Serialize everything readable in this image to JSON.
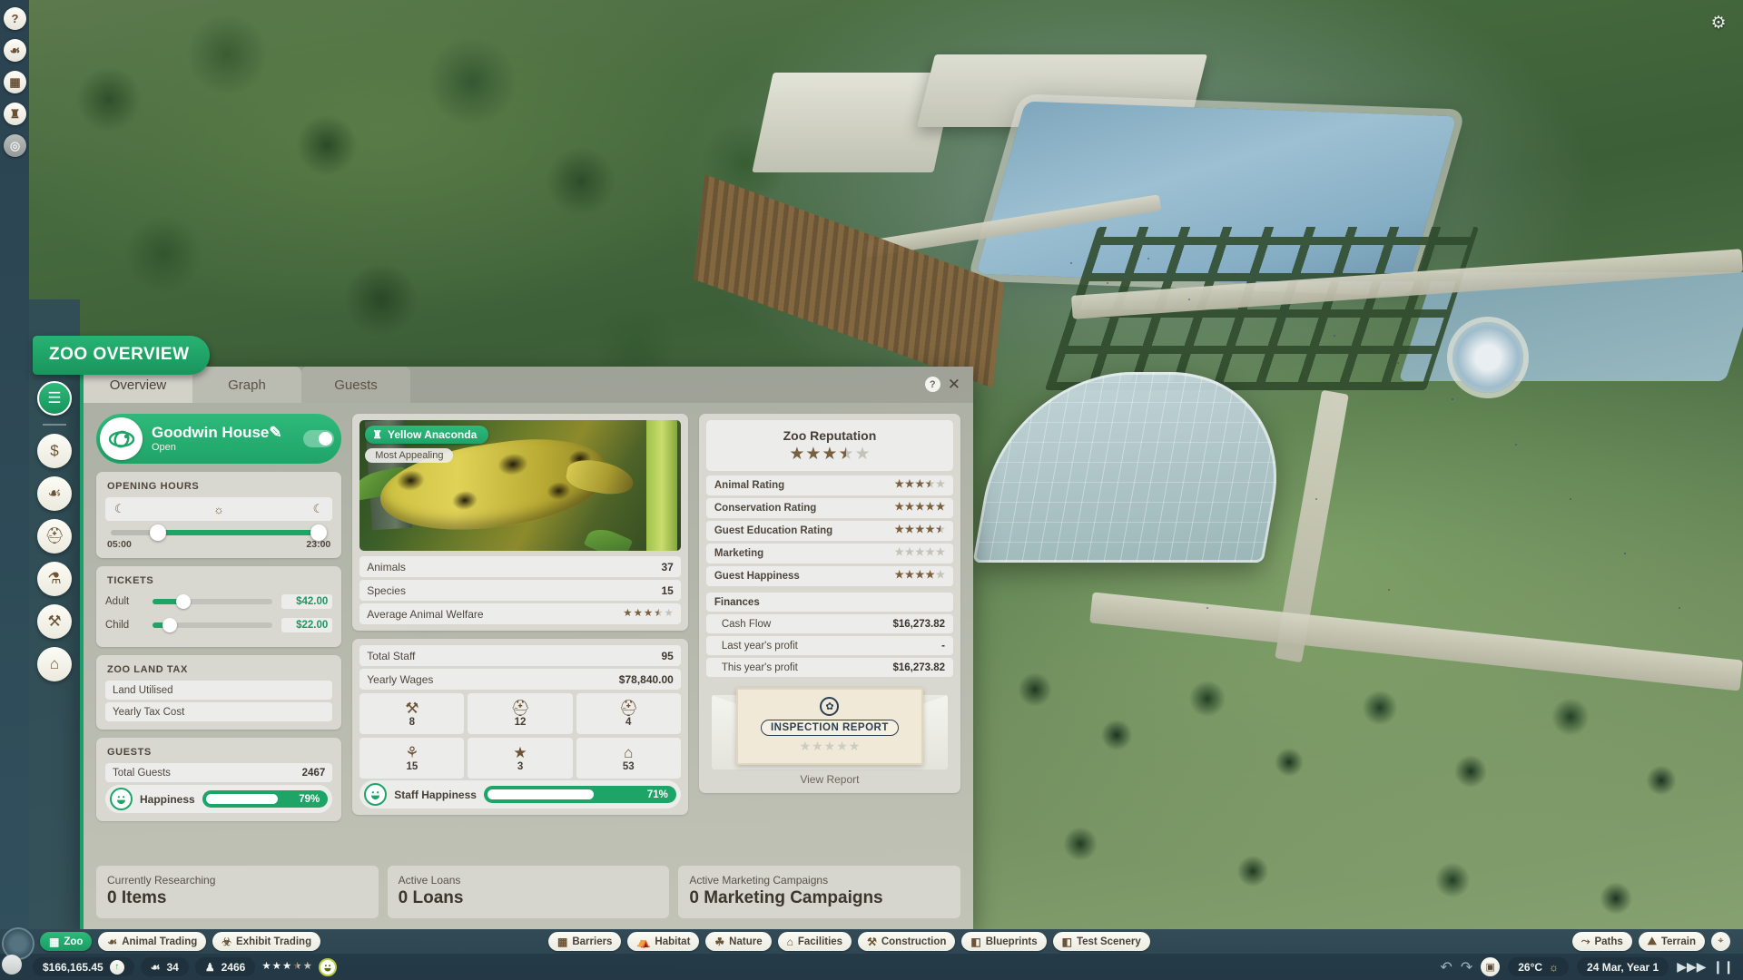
{
  "window": {
    "title": "ZOO OVERVIEW",
    "tabs": [
      {
        "label": "Overview",
        "active": true
      },
      {
        "label": "Graph",
        "active": false
      },
      {
        "label": "Guests",
        "active": false
      }
    ],
    "help_label": "?",
    "close_label": "✕"
  },
  "zoo": {
    "name": "Goodwin House",
    "name_edit_icon": "✎",
    "status": "Open",
    "logo_icon": "zoo-logo-icon"
  },
  "opening_hours": {
    "title": "OPENING HOURS",
    "icon_night_left": "☾",
    "icon_day": "☼",
    "icon_night_right": "☾",
    "start": "05:00",
    "end": "23:00",
    "fill_start_pct": 22,
    "fill_end_pct": 96
  },
  "tickets": {
    "title": "TICKETS",
    "rows": [
      {
        "label": "Adult",
        "price": "$42.00",
        "slider_pct": 26
      },
      {
        "label": "Child",
        "price": "$22.00",
        "slider_pct": 14
      }
    ]
  },
  "land_tax": {
    "title": "ZOO LAND TAX",
    "rows": [
      {
        "label": "Land Utilised",
        "value": ""
      },
      {
        "label": "Yearly Tax Cost",
        "value": ""
      }
    ]
  },
  "guests": {
    "title": "GUESTS",
    "total_label": "Total Guests",
    "total_value": "2467",
    "happiness_label": "Happiness",
    "happiness_value": "79%",
    "happiness_pct": 79,
    "face_icon": "◡"
  },
  "animal_card": {
    "badge_label": "Yellow Anaconda",
    "badge_icon": "♜",
    "sub_badge": "Most Appealing",
    "rows": [
      {
        "label": "Animals",
        "value": "37"
      },
      {
        "label": "Species",
        "value": "15"
      }
    ],
    "welfare_label": "Average Animal Welfare",
    "welfare_stars": 3.5
  },
  "staff": {
    "total_label": "Total Staff",
    "total_value": "95",
    "wages_label": "Yearly Wages",
    "wages_value": "$78,840.00",
    "cells": [
      {
        "icon": "⚒",
        "icon_name": "wrench-icon",
        "count": "8"
      },
      {
        "icon": "⛑",
        "icon_name": "keeper-icon",
        "count": "12"
      },
      {
        "icon": "⛑",
        "icon_name": "vet-bag-icon",
        "count": "4"
      },
      {
        "icon": "⚘",
        "icon_name": "broom-icon",
        "count": "15"
      },
      {
        "icon": "★",
        "icon_name": "security-badge-icon",
        "count": "3"
      },
      {
        "icon": "⌂",
        "icon_name": "shop-icon",
        "count": "53"
      }
    ],
    "happiness_label": "Staff Happiness",
    "happiness_value": "71%",
    "happiness_pct": 71
  },
  "reputation": {
    "title": "Zoo Reputation",
    "overall_stars": 3.5,
    "rows": [
      {
        "label": "Animal Rating",
        "stars": 3.5
      },
      {
        "label": "Conservation Rating",
        "stars": 5
      },
      {
        "label": "Guest Education Rating",
        "stars": 4.5
      },
      {
        "label": "Marketing",
        "stars": 0
      },
      {
        "label": "Guest Happiness",
        "stars": 4
      }
    ]
  },
  "finances": {
    "title": "Finances",
    "rows": [
      {
        "label": "Cash Flow",
        "value": "$16,273.82"
      },
      {
        "label": "Last year's profit",
        "value": "-"
      },
      {
        "label": "This year's profit",
        "value": "$16,273.82"
      }
    ]
  },
  "inspection": {
    "seal_icon": "✿",
    "title": "INSPECTION REPORT",
    "stars": 0,
    "view_label": "View Report"
  },
  "bottom_cards": [
    {
      "label": "Currently Researching",
      "value": "0 Items"
    },
    {
      "label": "Active Loans",
      "value": "0 Loans"
    },
    {
      "label": "Active Marketing Campaigns",
      "value": "0 Marketing Campaigns"
    }
  ],
  "left_rail_icons": [
    {
      "name": "help-icon",
      "glyph": "?"
    },
    {
      "name": "animal-book-icon",
      "glyph": "☙"
    },
    {
      "name": "calendar-icon",
      "glyph": "▦"
    },
    {
      "name": "trophy-icon",
      "glyph": "♜"
    },
    {
      "name": "eye-icon",
      "glyph": "◎"
    }
  ],
  "panel_side_icons": [
    {
      "name": "clipboard-icon",
      "glyph": "☰",
      "active": true
    },
    {
      "name": "finance-icon",
      "glyph": "$"
    },
    {
      "name": "paw-icon",
      "glyph": "☙"
    },
    {
      "name": "staff-icon",
      "glyph": "⛑"
    },
    {
      "name": "research-icon",
      "glyph": "⚗"
    },
    {
      "name": "maintenance-icon",
      "glyph": "⚒"
    },
    {
      "name": "shops-icon",
      "glyph": "⌂"
    }
  ],
  "toolbar": {
    "gear_icon": "⚙",
    "left_pills": [
      {
        "label": "Zoo",
        "icon": "▦",
        "icon_name": "zoo-icon",
        "active": true
      },
      {
        "label": "Animal Trading",
        "icon": "☙",
        "icon_name": "paw-icon",
        "active": false
      },
      {
        "label": "Exhibit Trading",
        "icon": "☣",
        "icon_name": "bug-icon",
        "active": false
      }
    ],
    "center_pills": [
      {
        "label": "Barriers",
        "icon": "▦",
        "icon_name": "barrier-icon"
      },
      {
        "label": "Habitat",
        "icon": "⛺",
        "icon_name": "habitat-icon"
      },
      {
        "label": "Nature",
        "icon": "☘",
        "icon_name": "nature-icon"
      },
      {
        "label": "Facilities",
        "icon": "⌂",
        "icon_name": "facilities-icon"
      },
      {
        "label": "Construction",
        "icon": "⚒",
        "icon_name": "construction-icon"
      },
      {
        "label": "Blueprints",
        "icon": "◧",
        "icon_name": "blueprints-icon"
      },
      {
        "label": "Test Scenery",
        "icon": "◧",
        "icon_name": "test-scenery-icon"
      }
    ],
    "right_pills": [
      {
        "label": "Paths",
        "icon": "⤳",
        "icon_name": "paths-icon"
      },
      {
        "label": "Terrain",
        "icon": "⛰",
        "icon_name": "terrain-icon"
      }
    ],
    "selection_icon": "⌖",
    "money": "$166,165.45",
    "money_trend_icon": "↑",
    "animals_icon": "☙",
    "animals_count": "34",
    "guests_icon": "♟",
    "guests_count": "2466",
    "rating_stars": 3.5,
    "mood_icon": "◡",
    "undo_icon": "↶",
    "redo_icon": "↷",
    "photo_icon": "▣",
    "temperature": "26°C",
    "weather_icon": "☼",
    "date": "24 Mar, Year 1",
    "fastforward_icon": "▶▶▶",
    "pause_icon": "❙❙"
  },
  "colors": {
    "accent_green": "#1fa468",
    "panel_bg": "#d8d8d0",
    "text_dark": "#4f473d",
    "star_filled": "#7a5f3e",
    "star_empty": "#c4c2b9",
    "money_green": "#1a9a61"
  }
}
